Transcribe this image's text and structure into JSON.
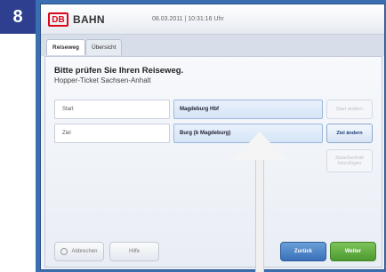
{
  "step": "8",
  "header": {
    "logo": "DB",
    "brand": "BAHN",
    "datetime": "08.03.2011 | 10:31:16 Uhr"
  },
  "tabs": [
    "Reiseweg",
    "Übersicht"
  ],
  "page": {
    "title": "Bitte prüfen Sie Ihren Reiseweg.",
    "subtitle": "Hopper-Ticket Sachsen-Anhalt"
  },
  "route": {
    "start_label": "Start",
    "start_value": "Magdeburg Hbf",
    "start_change": "Start ändern",
    "ziel_label": "Ziel",
    "ziel_value": "Burg (b Magdeburg)",
    "ziel_change": "Ziel ändern",
    "via_button": "Zwischenhalt hinzufügen"
  },
  "footer": {
    "cancel": "Abbrechen",
    "help": "Hilfe",
    "back": "Zurück",
    "next": "Weiter"
  }
}
